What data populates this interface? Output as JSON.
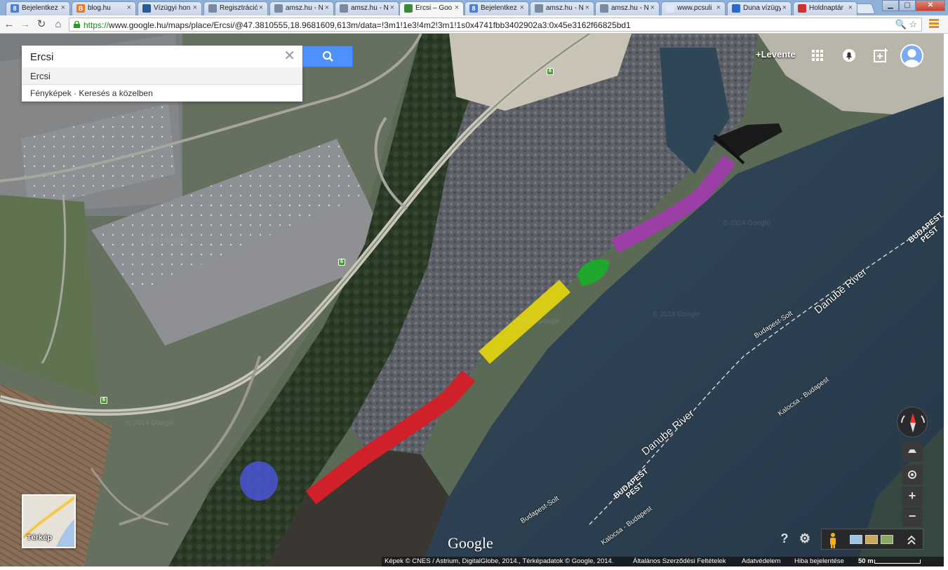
{
  "browser": {
    "tabs": [
      {
        "title": "Bejelentkez",
        "icon_color": "#4b7fd6",
        "icon_glyph": "8",
        "active": false
      },
      {
        "title": "blog.hu",
        "icon_color": "#e87b1e",
        "icon_glyph": "B",
        "active": false
      },
      {
        "title": "Vízügyi hon",
        "icon_color": "#2a5a9a",
        "icon_glyph": "",
        "active": false
      },
      {
        "title": "Regisztráció",
        "icon_color": "#7a8aa0",
        "icon_glyph": "",
        "active": false
      },
      {
        "title": "amsz.hu - N",
        "icon_color": "#7a8aa0",
        "icon_glyph": "",
        "active": false
      },
      {
        "title": "amsz.hu - N",
        "icon_color": "#7a8aa0",
        "icon_glyph": "",
        "active": false
      },
      {
        "title": "Ercsi – Goo",
        "icon_color": "#3a8a3a",
        "icon_glyph": "",
        "active": true
      },
      {
        "title": "Bejelentkez",
        "icon_color": "#4b7fd6",
        "icon_glyph": "8",
        "active": false
      },
      {
        "title": "amsz.hu - N",
        "icon_color": "#7a8aa0",
        "icon_glyph": "",
        "active": false
      },
      {
        "title": "amsz.hu - N",
        "icon_color": "#7a8aa0",
        "icon_glyph": "",
        "active": false
      },
      {
        "title": "www.pcsuli",
        "icon_color": "#dfe8f4",
        "icon_glyph": "",
        "active": false
      },
      {
        "title": "Duna vízügy",
        "icon_color": "#2a6acc",
        "icon_glyph": "",
        "active": false
      },
      {
        "title": "Holdnaptár",
        "icon_color": "#d03030",
        "icon_glyph": "",
        "active": false
      }
    ],
    "tab_close_glyph": "×",
    "window_buttons": {
      "minimize": "▁",
      "maximize": "▢",
      "close": "✕"
    },
    "nav": {
      "back": "←",
      "forward": "→",
      "reload": "↻",
      "home": "⌂"
    },
    "url_scheme": "https://",
    "url_rest": "www.google.hu/maps/place/Ercsi/@47.3810555,18.9681609,613m/data=!3m1!1e3!4m2!3m1!1s0x4741fbb3402902a3:0x45e3162f66825bd1",
    "omni_icons": "🔍 ☆"
  },
  "maps": {
    "search": {
      "value": "Ercsi",
      "clear_glyph": "✕"
    },
    "suggestions": [
      "Ercsi",
      "Fényképek · Keresés a közelben"
    ],
    "user_link": "+Levente",
    "top_icons": [
      "apps-icon",
      "notifications-icon",
      "share-icon",
      "account-icon"
    ],
    "minimap_label": "Térkép",
    "google_logo": "Google",
    "footer": {
      "imagery": "Képek © CNES / Astrium, DigitalGlobe, 2014., Térképadatok © Google, 2014.",
      "terms": "Általános Szerződési Feltételek",
      "privacy": "Adatvédelem",
      "report": "Hiba bejelentése",
      "scale": "50 m"
    },
    "controls": {
      "zoom_in": "+",
      "zoom_out": "−",
      "help": "?",
      "settings": "⚙"
    },
    "road_number": "6",
    "labels": {
      "danube_1": "Danube River",
      "danube_2": "Danube River",
      "budapest_solt_1": "Budapest-Solt",
      "budapest_solt_2": "Budapest-Solt",
      "kalocsa_1": "Kalocsa - Budapest",
      "kalocsa_2": "Kalocsa - Budapest",
      "budapest_pest_1_a": "BUDAPEST",
      "budapest_pest_1_b": "PEST",
      "budapest_pest_2_a": "BUDAPEST",
      "budapest_pest_2_b": "PEST",
      "watermark": "© 2014 Google"
    },
    "overlay_colors": {
      "red": "#d0202a",
      "yellow": "#d8cc14",
      "green": "#1fa82c",
      "purple": "#9b3fa6",
      "blue": "#4a55d8"
    }
  }
}
